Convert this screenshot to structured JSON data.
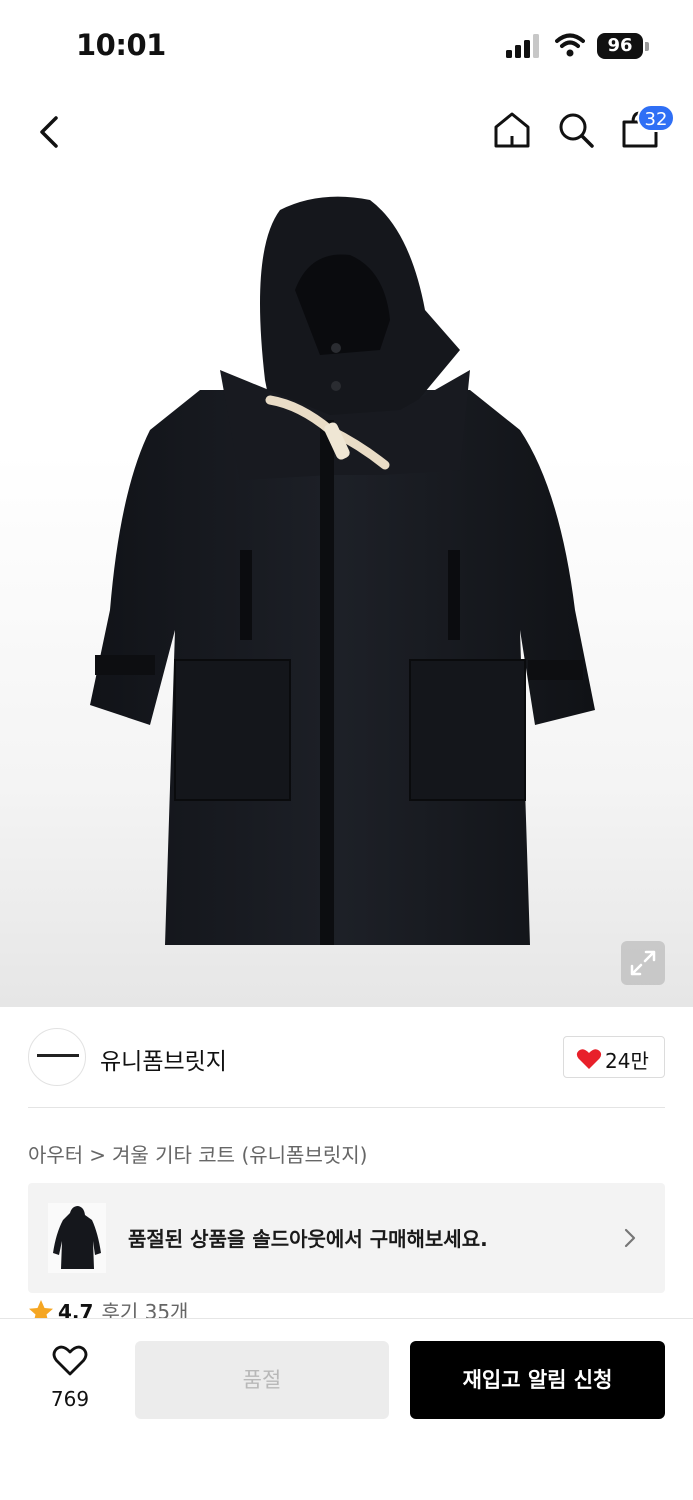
{
  "status_bar": {
    "time": "10:01",
    "battery": "96"
  },
  "header": {
    "cart_count": "32"
  },
  "brand": {
    "name": "유니폼브릿지",
    "likes": "24만"
  },
  "breadcrumb": {
    "items": [
      "아우터",
      "겨울 기타 코트 (유니폼브릿지)"
    ],
    "separator": ">"
  },
  "soldout_banner": {
    "text": "품절된 상품을 솔드아웃에서 구매해보세요."
  },
  "rating": {
    "score": "4.7",
    "reviews": "후기 35개"
  },
  "bottom_bar": {
    "wish_count": "769",
    "soldout_label": "품절",
    "restock_label": "재입고 알림 신청"
  },
  "colors": {
    "accent_blue": "#2f6ff5",
    "heart_red": "#e8202a",
    "star_orange": "#f5a623",
    "primary_black": "#000000"
  }
}
